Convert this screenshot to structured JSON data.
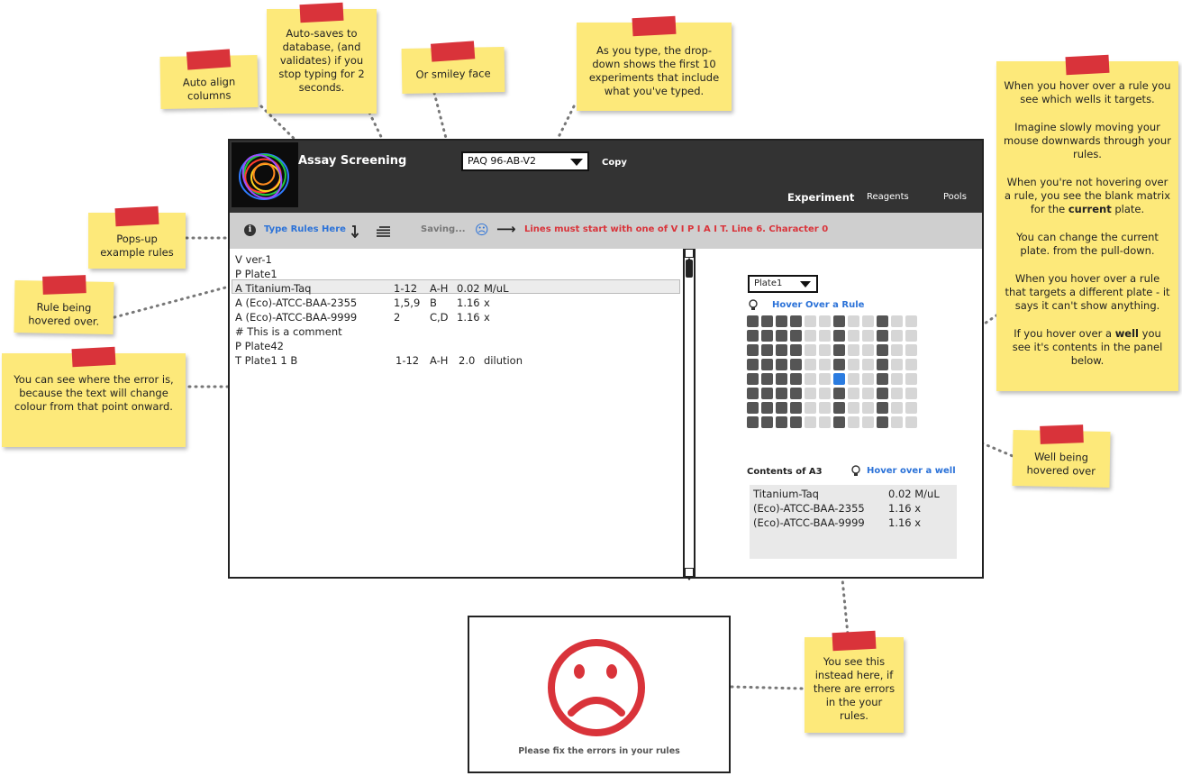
{
  "header": {
    "app_title": "Assay Screening",
    "experiment_select_value": "PAQ 96-AB-V2",
    "copy_label": "Copy",
    "nav": {
      "experiment": "Experiment",
      "reagents": "Reagents",
      "pools": "Pools"
    }
  },
  "toolbar": {
    "info_icon": "i",
    "type_rules_label": "Type Rules Here",
    "saving_label": "Saving...",
    "smiley": "☹",
    "arrow": "⟶",
    "error_message": "Lines must start with one of V I P I A I T. Line 6. Character 0"
  },
  "editor": {
    "lines": [
      {
        "c1": "V ver-1",
        "c2": "",
        "c3": "",
        "c4": "",
        "c5": ""
      },
      {
        "c1": "P Plate1",
        "c2": "",
        "c3": "",
        "c4": "",
        "c5": ""
      },
      {
        "c1": "A Titanium-Taq",
        "c2": "1-12",
        "c3": "A-H",
        "c4": "0.02",
        "c5": "M/uL"
      },
      {
        "c1": "A (Eco)-ATCC-BAA-2355",
        "c2": "1,5,9",
        "c3": "B",
        "c4": "1.16",
        "c5": "x"
      },
      {
        "c1": "A (Eco)-ATCC-BAA-9999",
        "c2": "2",
        "c3": "C,D",
        "c4": "1.16",
        "c5": "x"
      },
      {
        "c1": "# This is a comment",
        "c2": "",
        "c3": "",
        "c4": "",
        "c5": ""
      },
      {
        "c1": "P Plate42",
        "c2": "",
        "c3": "",
        "c4": "",
        "c5": ""
      },
      {
        "c1": "T Plate1 1 B",
        "c2": "1-12",
        "c3": "A-H",
        "c4": "2.0",
        "c5": "dilution"
      }
    ]
  },
  "plate": {
    "select_value": "Plate1",
    "hover_rule_label": "Hover Over a Rule",
    "contents_label": "Contents of A3",
    "hover_well_label": "Hover over a well",
    "contents": [
      {
        "name": "Titanium-Taq",
        "value": "0.02 M/uL"
      },
      {
        "name": "(Eco)-ATCC-BAA-2355",
        "value": "1.16 x"
      },
      {
        "name": "(Eco)-ATCC-BAA-9999",
        "value": "1.16 x"
      }
    ],
    "colors": {
      "targeted": "#555555",
      "empty": "#d6d6d6",
      "hovered": "#2b7ce0"
    }
  },
  "sad_panel": {
    "message": "Please fix the errors in your rules"
  },
  "notes": {
    "auto_align": "Auto align columns",
    "autosave": "Auto-saves to database, (and validates) if you stop typing for 2 seconds.",
    "smiley": "Or smiley face",
    "dropdown": "As you type, the drop-down shows the first 10 experiments that include what you've typed.",
    "popup": "Pops-up example rules",
    "rule_hovered": "Rule being hovered over.",
    "error_text": "You can see where the error is, because the text will change colour from that point onward.",
    "well_hovered": "Well being hovered over",
    "instead": "You see this instead here, if there are errors in the your rules.",
    "right_1": "When you hover over a rule you see which wells it targets.",
    "right_2": "Imagine slowly moving your mouse downwards through your rules.",
    "right_3a": "When you're not hovering over a rule, you see the blank matrix for the ",
    "right_3b": "current",
    "right_3c": " plate.",
    "right_4": "You can change the current plate. from the pull-down.",
    "right_5": "When you hover over a rule that targets a different plate - it says it can't show anything.",
    "right_6a": "If you hover over a ",
    "right_6b": "well",
    "right_6c": " you see it's contents in the panel below."
  }
}
